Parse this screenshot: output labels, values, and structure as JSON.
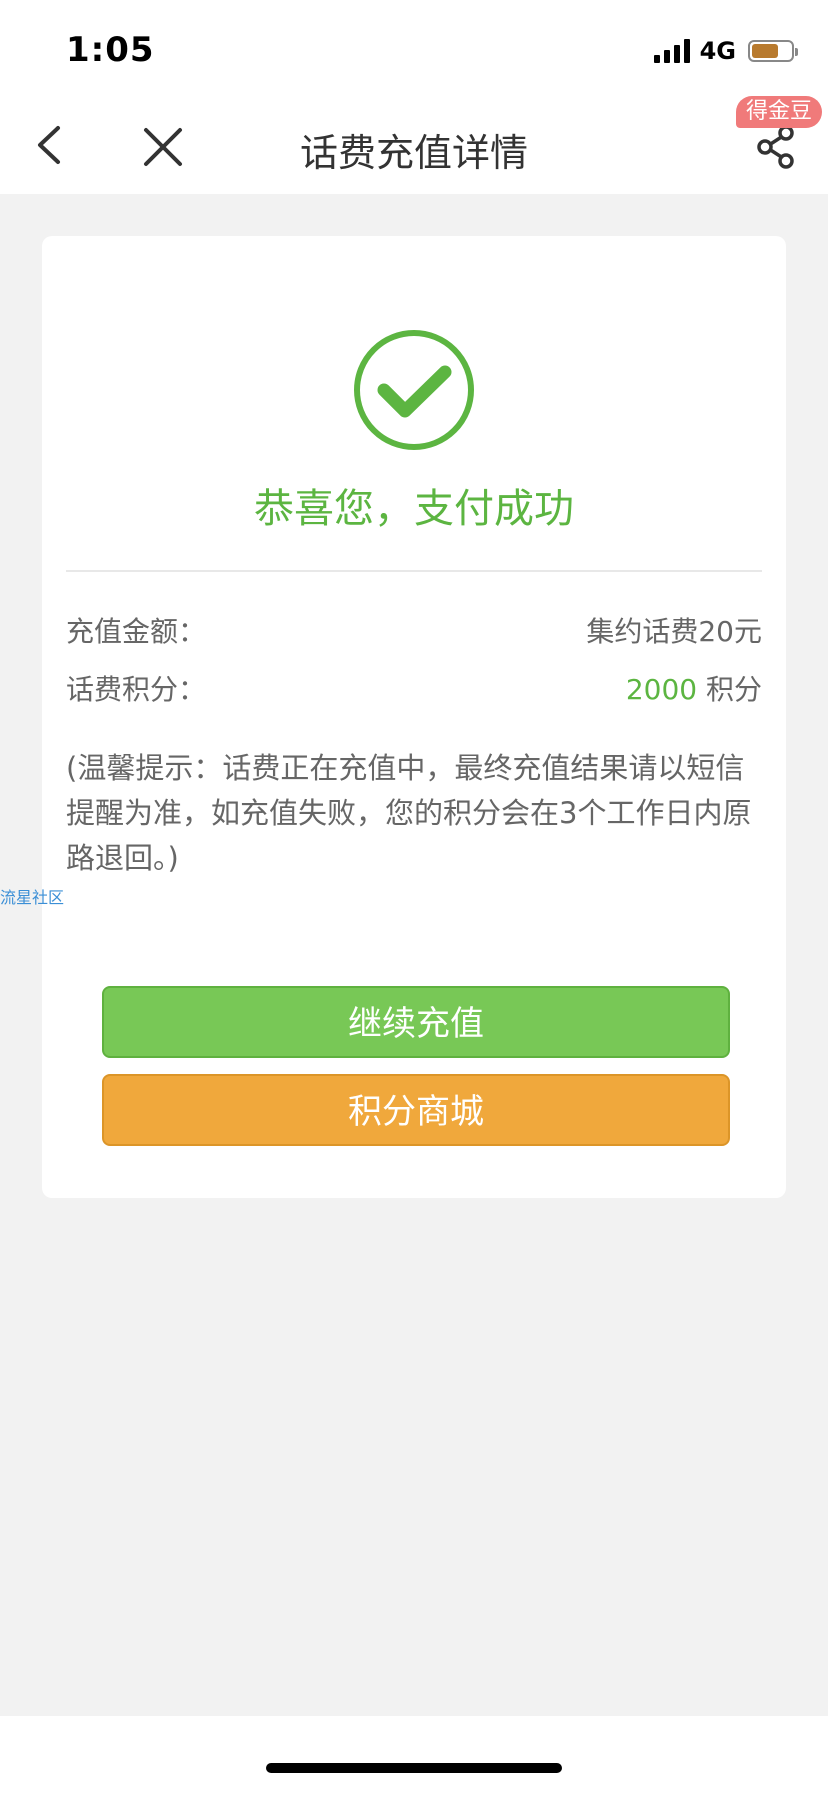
{
  "status_bar": {
    "time": "1:05",
    "network": "4G",
    "battery_level": 0.68
  },
  "nav": {
    "title": "话费充值详情",
    "badge": "得金豆",
    "back_icon": "chevron-left-icon",
    "close_icon": "close-icon",
    "share_icon": "share-icon"
  },
  "result": {
    "icon": "check-circle-icon",
    "title": "恭喜您，支付成功"
  },
  "details": {
    "amount_label": "充值金额：",
    "amount_value": "集约话费20元",
    "points_label": "话费积分：",
    "points_number": "2000",
    "points_unit": "积分"
  },
  "notice": "(温馨提示：话费正在充值中，最终充值结果请以短信提醒为准，如充值失败，您的积分会在3个工作日内原路退回。)",
  "buttons": {
    "continue": "继续充值",
    "mall": "积分商城"
  },
  "watermark": "流星社区",
  "colors": {
    "success_green": "#5cb541",
    "button_green": "#78c856",
    "button_orange": "#f0a83c",
    "badge_red": "#f07a7a"
  }
}
